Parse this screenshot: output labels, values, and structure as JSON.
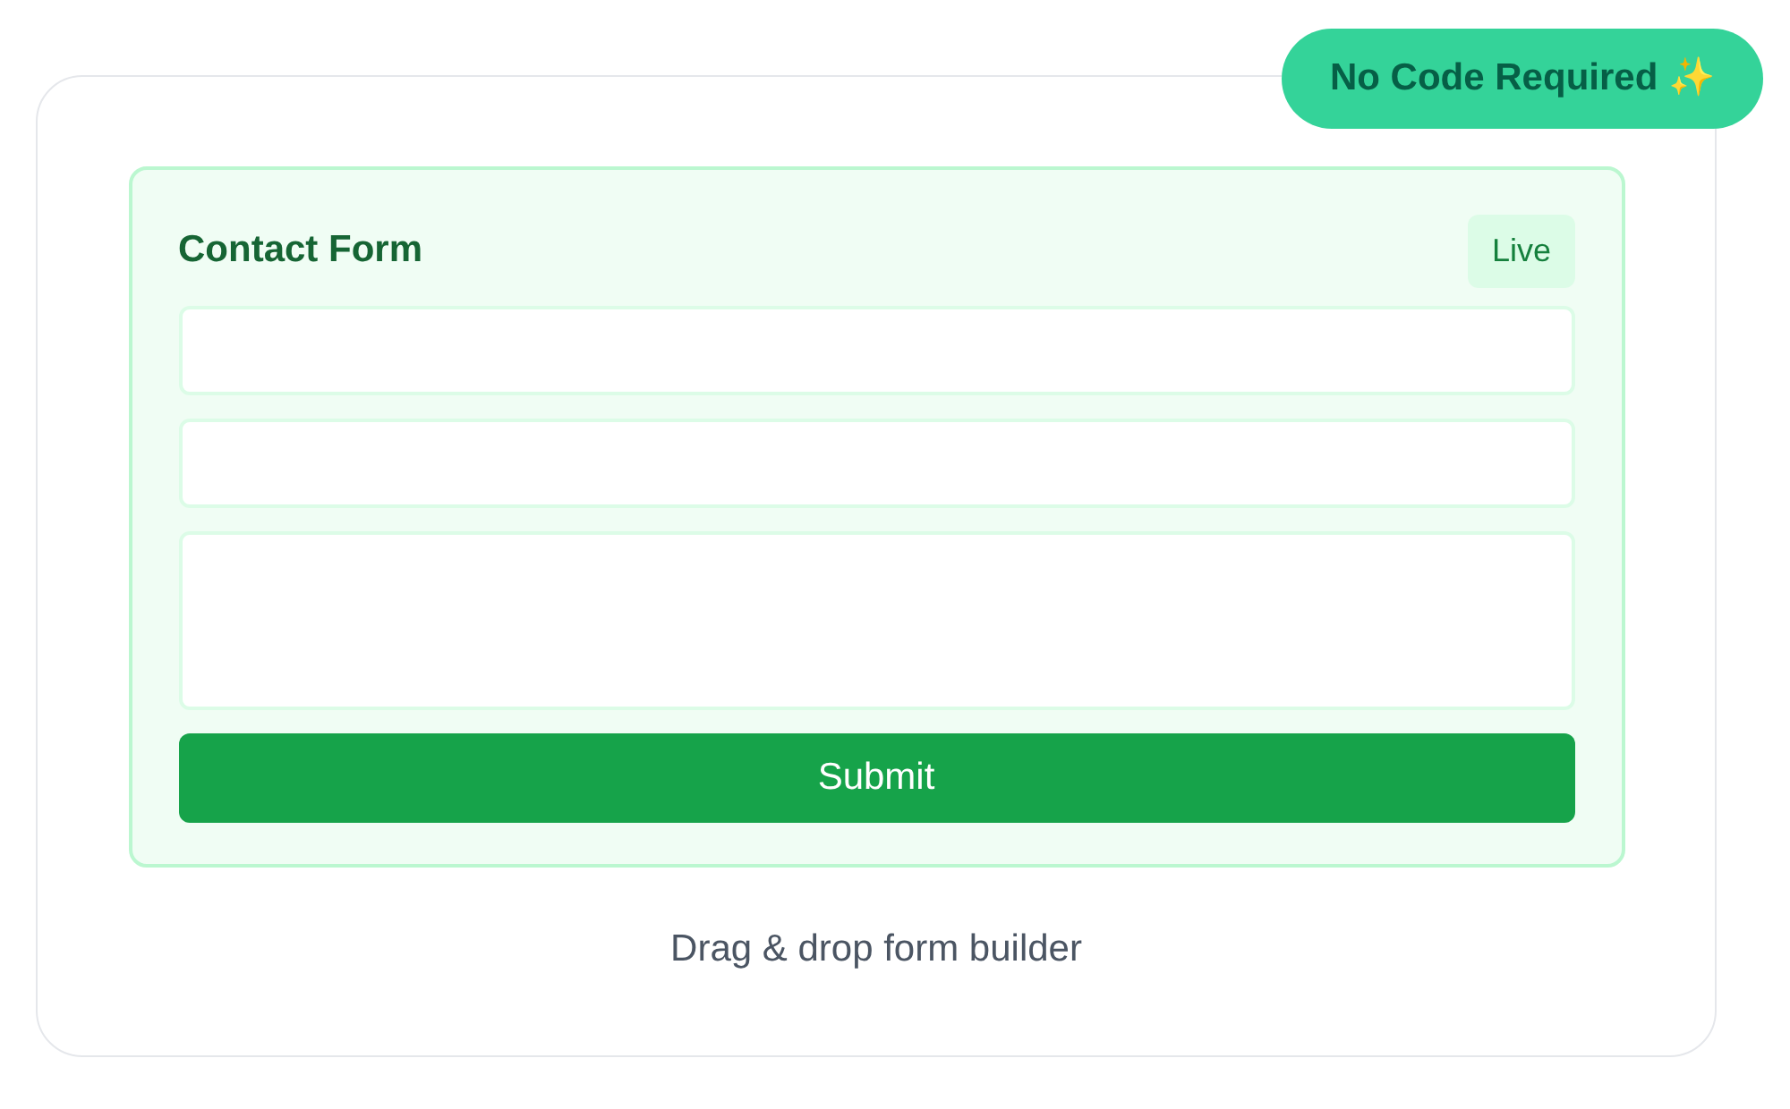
{
  "badge": "No Code Required ✨",
  "form": {
    "title": "Contact Form",
    "status": "Live",
    "fields": [
      {
        "kind": "input"
      },
      {
        "kind": "input"
      },
      {
        "kind": "textarea"
      }
    ],
    "submit": "Submit"
  },
  "caption": "Drag & drop form builder"
}
